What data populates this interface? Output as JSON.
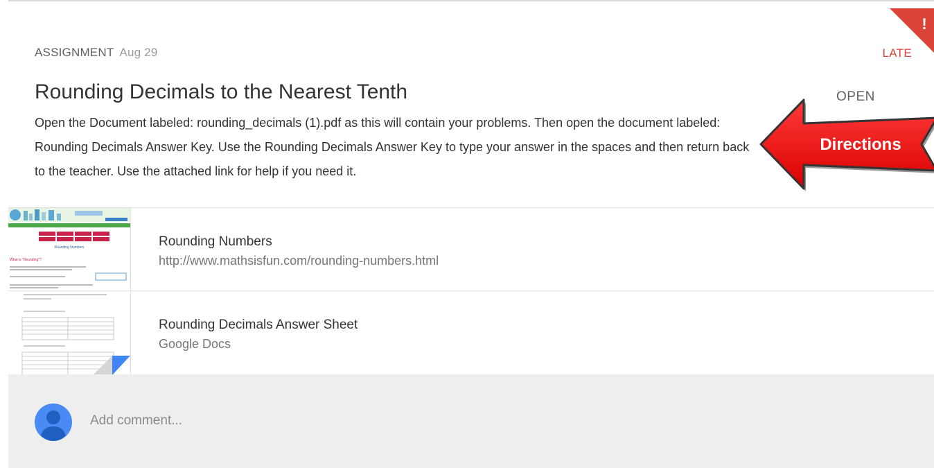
{
  "assignment": {
    "type_label": "ASSIGNMENT",
    "date": "Aug 29",
    "status": "LATE",
    "corner_icon_glyph": "!",
    "title": "Rounding Decimals to the Nearest Tenth",
    "open_label": "OPEN",
    "description": "Open the Document labeled: rounding_decimals (1).pdf as this will contain your problems. Then open the document labeled: Rounding Decimals Answer Key. Use the Rounding Decimals Answer Key to type your answer in the spaces and then return back to the teacher. Use the attached link for help if you need it."
  },
  "annotation": {
    "arrow_label": "Directions",
    "arrow_color": "#ff0000"
  },
  "attachments": [
    {
      "title": "Rounding Numbers",
      "subtitle": "http://www.mathsisfun.com/rounding-numbers.html",
      "kind": "link",
      "thumb_heading": "Rounding Numbers",
      "thumb_subheading": "What is \"Rounding\"?"
    },
    {
      "title": "Rounding Decimals Answer Sheet",
      "subtitle": "Google Docs",
      "kind": "google-doc"
    }
  ],
  "comment": {
    "placeholder": "Add comment..."
  },
  "colors": {
    "late": "#db4437",
    "corner_flag": "#db4437",
    "comment_bg": "#eeeeee",
    "avatar_bg": "#4a8af4",
    "doc_fold": "#4285f4"
  }
}
